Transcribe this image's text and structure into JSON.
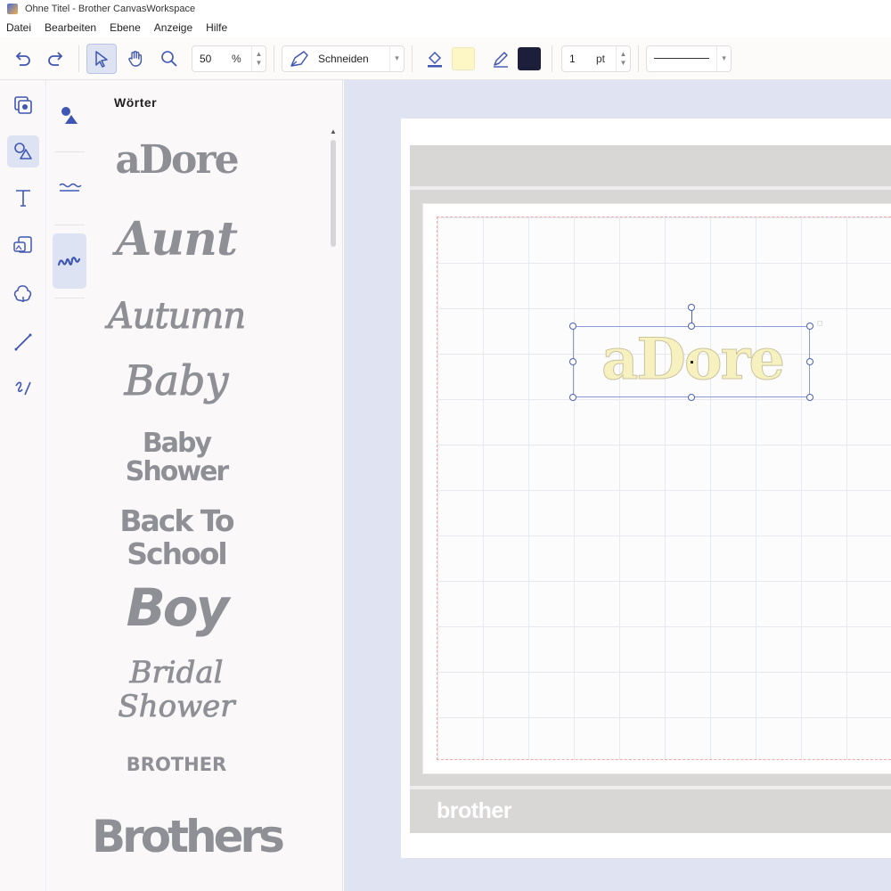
{
  "window": {
    "title": "Ohne Titel - Brother CanvasWorkspace"
  },
  "menu": [
    "Datei",
    "Bearbeiten",
    "Ebene",
    "Anzeige",
    "Hilfe"
  ],
  "toolbar": {
    "zoom_value": "50",
    "zoom_unit": "%",
    "mode_label": "Schneiden",
    "line_width_value": "1",
    "line_width_unit": "pt",
    "fill_color": "#fdf7c6",
    "line_color": "#1d1f3a"
  },
  "library": {
    "title": "Wörter",
    "words": [
      "aDore",
      "Aunt",
      "Autumn",
      "Baby",
      "Baby Shower",
      "Back To School",
      "Boy",
      "Bridal Shower",
      "BROTHER",
      "Brothers"
    ]
  },
  "canvas": {
    "selected_text": "aDore",
    "brand": "brother"
  },
  "colors": {
    "accent": "#4b5fb8",
    "canvas_bg": "#dfe3f2",
    "mat": "#d9d6d6"
  }
}
